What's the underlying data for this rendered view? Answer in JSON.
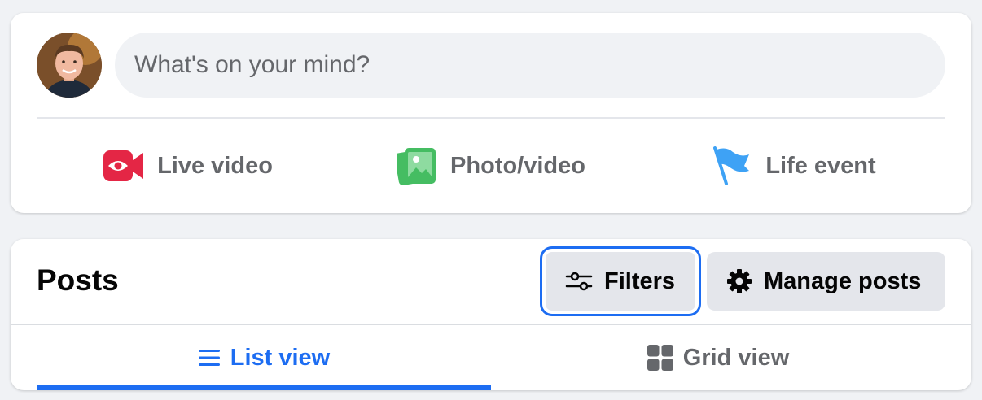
{
  "composer": {
    "avatar_icon": "user-avatar",
    "placeholder": "What's on your mind?",
    "actions": [
      {
        "label": "Live video",
        "icon": "live-video-icon",
        "color": "#e42645"
      },
      {
        "label": "Photo/video",
        "icon": "photo-icon",
        "color": "#45bd62"
      },
      {
        "label": "Life event",
        "icon": "flag-icon",
        "color": "#3ea2f5"
      }
    ]
  },
  "posts": {
    "title": "Posts",
    "filters_label": "Filters",
    "manage_label": "Manage posts",
    "tabs": [
      {
        "label": "List view",
        "icon": "list-icon",
        "active": true
      },
      {
        "label": "Grid view",
        "icon": "grid-icon",
        "active": false
      }
    ]
  },
  "colors": {
    "accent": "#1d6df2",
    "background": "#f0f2f5",
    "secondary_text": "#65676b"
  }
}
